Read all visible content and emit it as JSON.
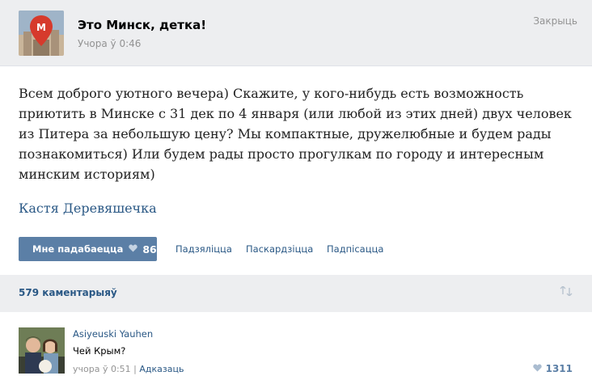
{
  "header": {
    "group_name": "Это Минск, детка!",
    "post_time": "Учора ў 0:46",
    "close_label": "Закрыць"
  },
  "post": {
    "lines": [
      "Всем доброго уютного вечера) Скажите, у кого-нибудь есть возможность",
      "приютить в Минске с 31 дек по 4 января (или любой из этих дней) двух человек",
      "из Питера за небольшую цену? Мы компактные, дружелюбные и будем рады",
      "познакомиться) Или будем рады просто прогулкам по городу и интересным",
      "минским историям)"
    ],
    "author": "Кастя Деревяшечка"
  },
  "actions": {
    "like_label": "Мне падабаецца",
    "like_count": "86",
    "comment_label": "Падзяліцца",
    "share_label": "Паскардзіцца",
    "subscribe_label": "Падпісацца"
  },
  "comments_bar": {
    "count_label": "579 каментарыяў"
  },
  "comment": {
    "author": "Asiyeuski Yauhen",
    "text": "Чей Крым?",
    "time": "учора ў 0:51",
    "separator": "|",
    "reply_label": "Адказаць",
    "likes": "1311"
  },
  "colors": {
    "accent": "#5b7fa6",
    "link": "#2a5885",
    "bar_bg": "#edeef0"
  },
  "icons": {
    "like": "heart-icon",
    "sort": "sort-arrows-icon"
  }
}
